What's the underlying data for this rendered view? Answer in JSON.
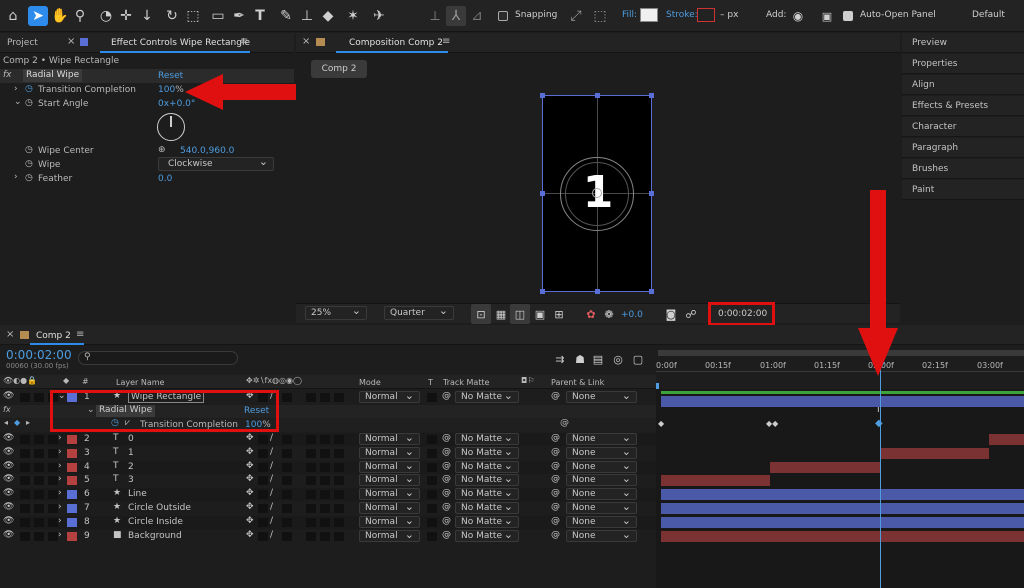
{
  "toolbar": {
    "snapping": "Snapping",
    "fill": "Fill:",
    "stroke": "Stroke:",
    "stroke_unit": "– px",
    "add": "Add:",
    "auto_open": "Auto-Open Panel",
    "workspace": "Default"
  },
  "left": {
    "tab_project": "Project",
    "tab_effect": "Effect Controls Wipe Rectangle",
    "breadcrumb": "Comp 2 • Wipe Rectangle",
    "effect_name": "Radial Wipe",
    "reset": "Reset",
    "props": {
      "tc_label": "Transition Completion",
      "tc_value": "100",
      "tc_unit": "%",
      "sa_label": "Start Angle",
      "sa_value": "0x+0.0°",
      "wc_label": "Wipe Center",
      "wc_value": "540.0,960.0",
      "wipe_label": "Wipe",
      "wipe_value": "Clockwise",
      "feather_label": "Feather",
      "feather_value": "0.0"
    }
  },
  "comp": {
    "tab": "Composition Comp 2",
    "subtab": "Comp 2",
    "frame_number": "1",
    "zoom": "25%",
    "quality": "Quarter",
    "exposure": "+0.0",
    "timecode": "0:00:02:00"
  },
  "right": {
    "items": [
      "Preview",
      "Properties",
      "Align",
      "Effects & Presets",
      "Character",
      "Paragraph",
      "Brushes",
      "Paint"
    ]
  },
  "timeline": {
    "tab": "Comp 2",
    "timecode": "0:00:02:00",
    "frames": "00060 (30.00 fps)",
    "search_placeholder": "",
    "headers": {
      "layer_name": "Layer Name",
      "mode": "Mode",
      "t": "T",
      "track_matte": "Track Matte",
      "parent": "Parent & Link"
    },
    "ruler": [
      "0:00f",
      "00:15f",
      "01:00f",
      "01:15f",
      "02:00f",
      "02:15f",
      "03:00f"
    ],
    "effect_row": {
      "name": "Radial Wipe",
      "reset": "Reset",
      "prop": "Transition Completion",
      "value": "100",
      "unit": "%"
    },
    "layers": [
      {
        "num": "1",
        "type": "★",
        "name": "Wipe Rectangle",
        "mode": "Normal",
        "matte": "No Matte",
        "parent": "None",
        "color": "#5a6fd6"
      },
      {
        "num": "2",
        "type": "T",
        "name": "0",
        "mode": "Normal",
        "matte": "No Matte",
        "parent": "None",
        "color": "#b54040"
      },
      {
        "num": "3",
        "type": "T",
        "name": "1",
        "mode": "Normal",
        "matte": "No Matte",
        "parent": "None",
        "color": "#b54040"
      },
      {
        "num": "4",
        "type": "T",
        "name": "2",
        "mode": "Normal",
        "matte": "No Matte",
        "parent": "None",
        "color": "#b54040"
      },
      {
        "num": "5",
        "type": "T",
        "name": "3",
        "mode": "Normal",
        "matte": "No Matte",
        "parent": "None",
        "color": "#b54040"
      },
      {
        "num": "6",
        "type": "★",
        "name": "Line",
        "mode": "Normal",
        "matte": "No Matte",
        "parent": "None",
        "color": "#5a6fd6"
      },
      {
        "num": "7",
        "type": "★",
        "name": "Circle Outside",
        "mode": "Normal",
        "matte": "No Matte",
        "parent": "None",
        "color": "#5a6fd6"
      },
      {
        "num": "8",
        "type": "★",
        "name": "Circle Inside",
        "mode": "Normal",
        "matte": "No Matte",
        "parent": "None",
        "color": "#5a6fd6"
      },
      {
        "num": "9",
        "type": "■",
        "name": "Background",
        "mode": "Normal",
        "matte": "No Matte",
        "parent": "None",
        "color": "#b54040"
      }
    ]
  },
  "colors": {
    "accent": "#2d8ceb",
    "highlight": "#e01010",
    "playhead": "#4d9de0"
  }
}
